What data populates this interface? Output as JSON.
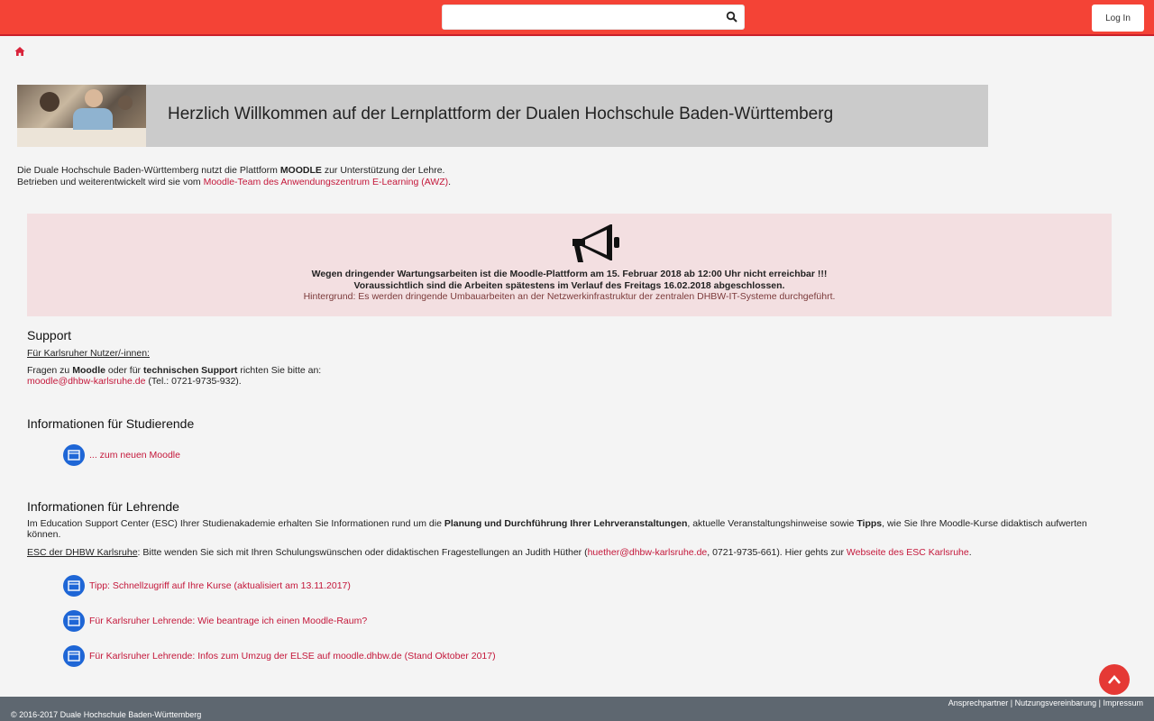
{
  "header": {
    "search_placeholder": "",
    "login_label": "Log In"
  },
  "banner": {
    "title": "Herzlich Willkommen auf der Lernplattform der Dualen Hochschule Baden-Württemberg"
  },
  "intro": {
    "line1_a": "Die Duale Hochschule Baden-Württemberg nutzt die Plattform ",
    "line1_b": "MOODLE",
    "line1_c": " zur Unterstützung der Lehre.",
    "line2_a": "Betrieben und weiterentwickelt wird sie vom ",
    "line2_link": "Moodle-Team des Anwendungszentrum E-Learning (AWZ)",
    "line2_end": "."
  },
  "notice": {
    "line1": "Wegen dringender Wartungsarbeiten ist die Moodle-Plattform am 15. Februar 2018 ab 12:00 Uhr nicht erreichbar !!!",
    "line2": "Voraussichtlich sind die Arbeiten spätestens im Verlauf des Freitags 16.02.2018 abgeschlossen.",
    "line3": "Hintergrund: Es werden dringende Umbauarbeiten an der Netzwerkinfrastruktur der zentralen DHBW-IT-Systeme durchgeführt."
  },
  "support": {
    "heading": "Support",
    "subheading": "Für Karlsruher Nutzer/-innen:",
    "text_a": "Fragen zu ",
    "text_b": "Moodle",
    "text_c": " oder für ",
    "text_d": "technischen Support",
    "text_e": " richten Sie bitte an:",
    "email": "moodle@dhbw-karlsruhe.de",
    "phone": " (Tel.: 0721-9735-932)."
  },
  "students": {
    "heading": "Informationen für Studierende",
    "link": "... zum neuen Moodle"
  },
  "teachers": {
    "heading": "Informationen für Lehrende",
    "p1_a": "Im Education Support Center (ESC) Ihrer Studienakademie erhalten Sie Informationen rund um die ",
    "p1_b": "Planung und Durchführung Ihrer Lehrveranstaltungen",
    "p1_c": ", aktuelle Veranstaltungshinweise sowie ",
    "p1_d": "Tipps",
    "p1_e": ", wie Sie Ihre Moodle-Kurse didaktisch aufwerten",
    "p1_f": "können.",
    "p2_label": "ESC der DHBW Karlsruhe",
    "p2_a": ": Bitte wenden Sie sich mit Ihren Schulungswünschen oder didaktischen Fragestellungen an Judith Hüther (",
    "p2_email": "huether@dhbw-karlsruhe.de",
    "p2_b": ", 0721-9735-661). Hier gehts zur ",
    "p2_link": "Webseite des ESC Karlsruhe",
    "p2_end": ".",
    "res1_prefix": "Tipp: ",
    "res1_link": "Schnellzugriff auf Ihre Kurse (aktualisiert am 13.11.2017)",
    "res2_prefix": "Für Karlsruher Lehrende: ",
    "res2_link": "Wie beantrage ich einen Moodle-Raum?",
    "res3_prefix": "Für Karlsruher Lehrende: ",
    "res3_link": "Infos zum Umzug der ELSE auf moodle.dhbw.de (Stand Oktober 2017)"
  },
  "footer": {
    "link1": "Ansprechpartner",
    "sep1": " | ",
    "link2": "Nutzungsvereinbarung",
    "sep2": " | ",
    "link3": "Impressum",
    "copyright": "© 2016-2017 Duale Hochschule Baden-Württemberg"
  }
}
